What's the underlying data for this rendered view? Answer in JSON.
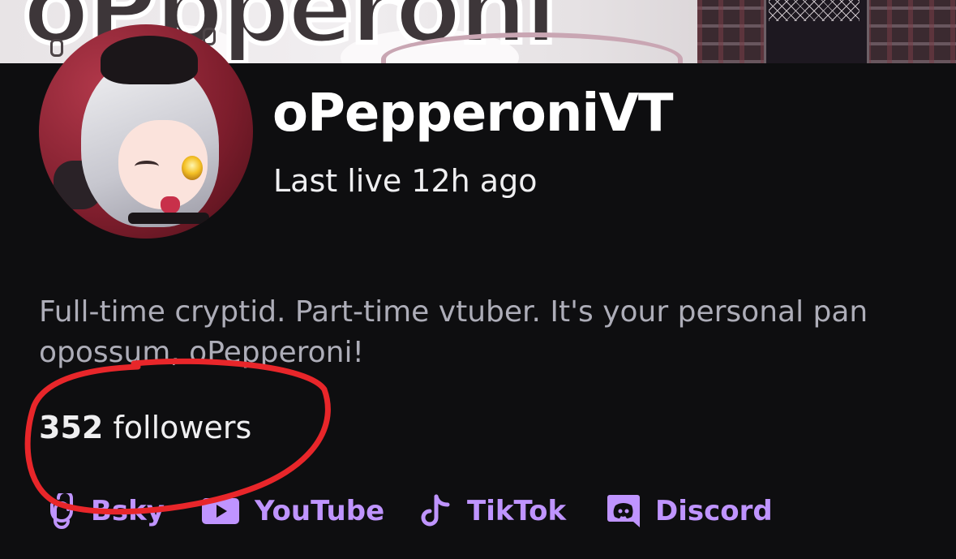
{
  "banner": {
    "letters": "oPpperoni",
    "colors": {
      "background": "#efeaec",
      "text": "#3d3639",
      "accent": "#b79aa6"
    }
  },
  "profile": {
    "avatar_icon": "avatar-image",
    "channel_name": "oPepperoniVT",
    "last_live": "Last live 12h ago",
    "bio": "Full-time cryptid. Part-time vtuber. It's your personal pan opossum, oPepperoni!",
    "followers": {
      "count": "352",
      "label": "followers"
    }
  },
  "socials": [
    {
      "label": "Bsky",
      "icon": "bluesky-link-icon"
    },
    {
      "label": "YouTube",
      "icon": "youtube-icon"
    },
    {
      "label": "TikTok",
      "icon": "tiktok-icon"
    },
    {
      "label": "Discord",
      "icon": "discord-icon"
    }
  ],
  "annotation": {
    "type": "hand-drawn circle",
    "color": "#e8262a"
  },
  "colors": {
    "background": "#0e0e10",
    "primary_text": "#efeff1",
    "secondary_text": "#adadb8",
    "link": "#bf94ff"
  }
}
